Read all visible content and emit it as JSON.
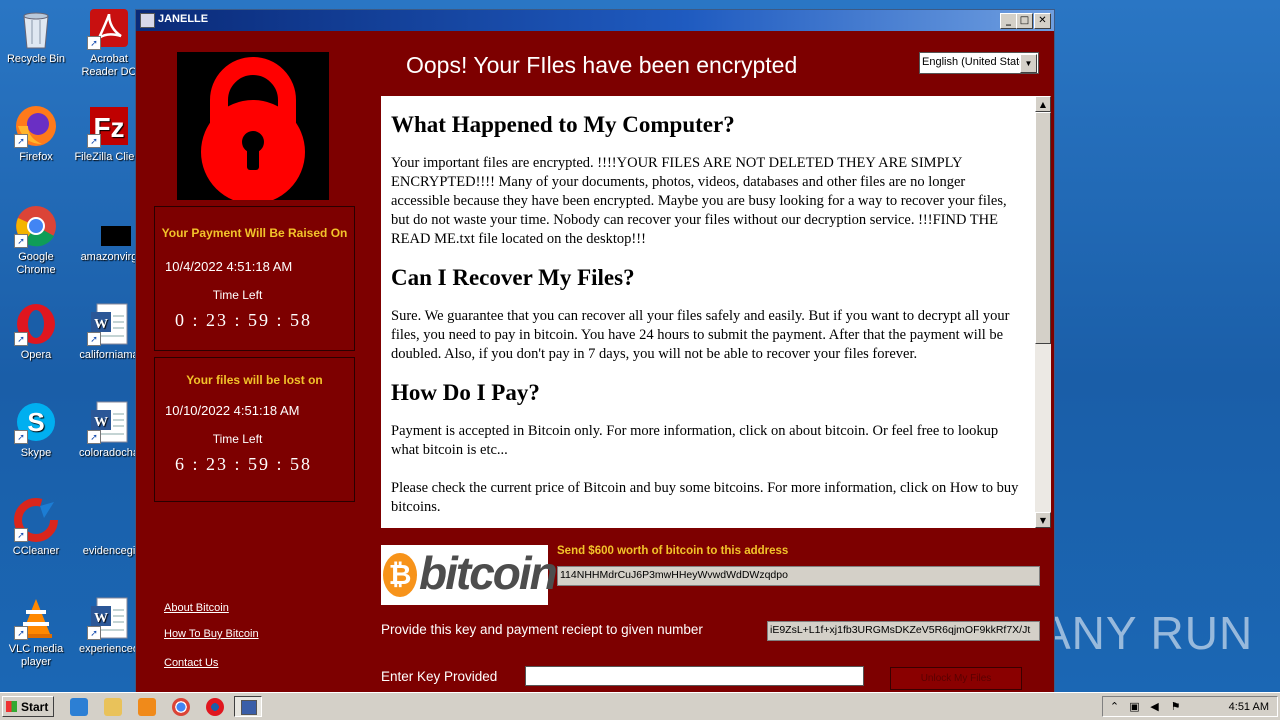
{
  "desktop": {
    "icons_col1": [
      {
        "label": "Recycle Bin",
        "icon": "recycle-bin-icon"
      },
      {
        "label": "Firefox",
        "icon": "firefox-icon"
      },
      {
        "label": "Google Chrome",
        "icon": "chrome-icon"
      },
      {
        "label": "Opera",
        "icon": "opera-icon"
      },
      {
        "label": "Skype",
        "icon": "skype-icon"
      },
      {
        "label": "CCleaner",
        "icon": "ccleaner-icon"
      },
      {
        "label": "VLC media player",
        "icon": "vlc-icon"
      }
    ],
    "icons_col2": [
      {
        "label": "Acrobat Reader DC",
        "icon": "acrobat-icon"
      },
      {
        "label": "FileZilla Client",
        "icon": "filezilla-icon"
      },
      {
        "label": "amazonvirg",
        "icon": "blank-file-icon"
      },
      {
        "label": "californiama",
        "icon": "word-doc-icon"
      },
      {
        "label": "coloradocha",
        "icon": "word-doc-icon"
      },
      {
        "label": "evidencegi",
        "icon": "blank-file-icon"
      },
      {
        "label": "experienceo",
        "icon": "word-doc-icon"
      }
    ],
    "watermark": "ANY RUN"
  },
  "window": {
    "title": "JANELLE",
    "heading": "Oops! Your FIles have been encrypted",
    "language": "English (United States)",
    "payment_box": {
      "heading": "Your Payment Will Be Raised On",
      "date": "10/4/2022 4:51:18 AM",
      "time_left_label": "Time Left",
      "countdown": "0 : 23 : 59 : 58"
    },
    "lost_box": {
      "heading": "Your files will be lost on",
      "date": "10/10/2022 4:51:18 AM",
      "time_left_label": "Time Left",
      "countdown": "6 : 23 : 59 : 58"
    },
    "links": {
      "about": "About Bitcoin",
      "how_to_buy": "How To Buy Bitcoin",
      "contact": "Contact Us"
    },
    "info": {
      "h1": "What Happened to My Computer?",
      "p1": "Your important files are encrypted. !!!!YOUR FILES ARE NOT DELETED THEY ARE SIMPLY ENCRYPTED!!!! Many of your documents, photos, videos, databases and other files are no longer accessible because they have been encrypted. Maybe you are busy looking for a way to recover your files, but do not waste your time. Nobody can recover your files without our decryption service. !!!FIND THE READ ME.txt file located on the desktop!!!",
      "h2": "Can I Recover My Files?",
      "p2": "Sure. We guarantee that you can recover all your files safely and easily. But if you want to decrypt all your files, you need to pay in bitcoin. You have 24 hours to submit the payment. After that the payment will be doubled. Also, if you don't pay in 7 days, you will not be able to recover your files forever.",
      "h3": "How Do I Pay?",
      "p3": "Payment is accepted in Bitcoin only. For more information, click on about bitcoin. Or feel free to lookup what bitcoin is etc...",
      "p4": "Please check the current price of Bitcoin and buy some bitcoins. For more information, click on How to buy bitcoins."
    },
    "bitcoin_logo_text": "bitcoin",
    "send_label": "Send $600 worth of bitcoin to this address",
    "btc_address": "114NHHMdrCuJ6P3mwHHeyWvwdWdDWzqdpo",
    "key_label": "Provide this key and payment reciept to given number",
    "key_value": "iE9ZsL+L1f+xj1fb3URGMsDKZeV5R6qjmOF9kkRf7X/Jt",
    "enter_key_label": "Enter Key Provided",
    "enter_key_value": "",
    "unlock_label": "Unlock My Files"
  },
  "taskbar": {
    "start_label": "Start",
    "clock": "4:51 AM"
  },
  "colors": {
    "window_bg": "#7d0000",
    "accent_yellow": "#f2c32a",
    "lock_red": "#ff0000"
  }
}
